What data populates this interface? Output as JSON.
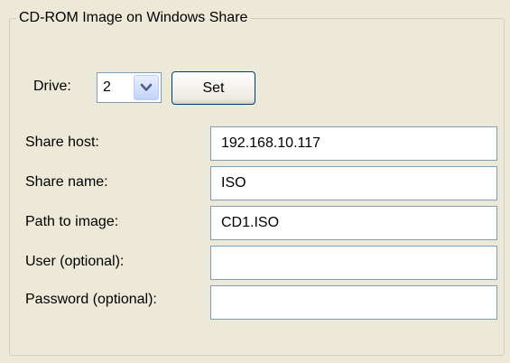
{
  "group": {
    "title": "CD-ROM Image on Windows Share"
  },
  "drive": {
    "label": "Drive:",
    "value": "2",
    "arrow_icon": "chevron-down-icon"
  },
  "set_button": {
    "label": "Set"
  },
  "fields": [
    {
      "label": "Share host:",
      "value": "192.168.10.117"
    },
    {
      "label": "Share name:",
      "value": "ISO"
    },
    {
      "label": "Path to image:",
      "value": "CD1.ISO"
    },
    {
      "label": "User (optional):",
      "value": ""
    },
    {
      "label": "Password (optional):",
      "value": ""
    }
  ],
  "colors": {
    "background": "#ece9d8",
    "input_border": "#7f9db9",
    "button_border": "#003c74",
    "arrow": "#4d6185"
  }
}
